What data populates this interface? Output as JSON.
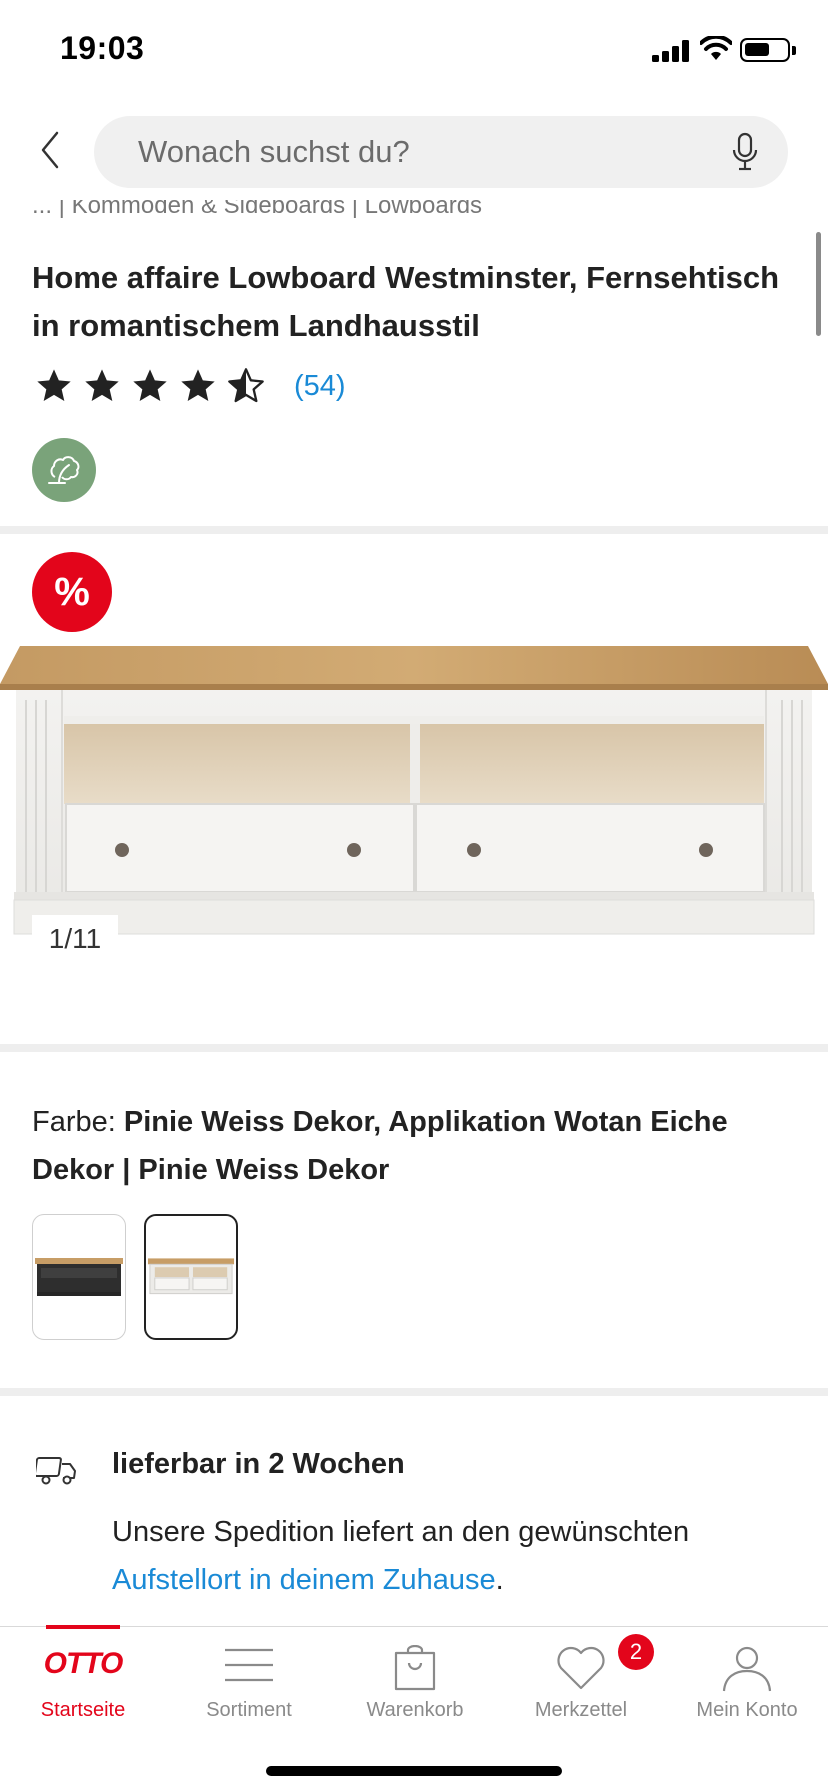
{
  "status_bar": {
    "time": "19:03"
  },
  "search": {
    "placeholder": "Wonach suchst du?"
  },
  "breadcrumb": "... | Kommoden & Sideboards | Lowboards",
  "product": {
    "title": "Home affaire Lowboard Westminster, Fernsehtisch in romantischem Landhausstil",
    "rating": 4.5,
    "rating_count": "(54)",
    "sale_badge": "%",
    "image_counter": "1/11"
  },
  "color": {
    "label": "Farbe: ",
    "value": "Pinie Weiss Dekor, Applikation Wotan Eiche Dekor | Pinie Weiss Dekor"
  },
  "delivery": {
    "title": "lieferbar in 2 Wochen",
    "text_before": "Unsere Spedition liefert an den gewünschten ",
    "link": "Aufstellort in deinem Zuhause",
    "text_after": "."
  },
  "nav": {
    "items": [
      {
        "label": "Startseite",
        "icon": "otto-logo",
        "logo_text": "OTTO",
        "active": true
      },
      {
        "label": "Sortiment",
        "icon": "menu-icon"
      },
      {
        "label": "Warenkorb",
        "icon": "shopping-bag-icon"
      },
      {
        "label": "Merkzettel",
        "icon": "heart-icon",
        "badge": "2"
      },
      {
        "label": "Mein Konto",
        "icon": "person-icon"
      }
    ]
  },
  "colors": {
    "accent": "#e3051b",
    "link": "#1a8ad6",
    "sustainability": "#7aa37a"
  }
}
